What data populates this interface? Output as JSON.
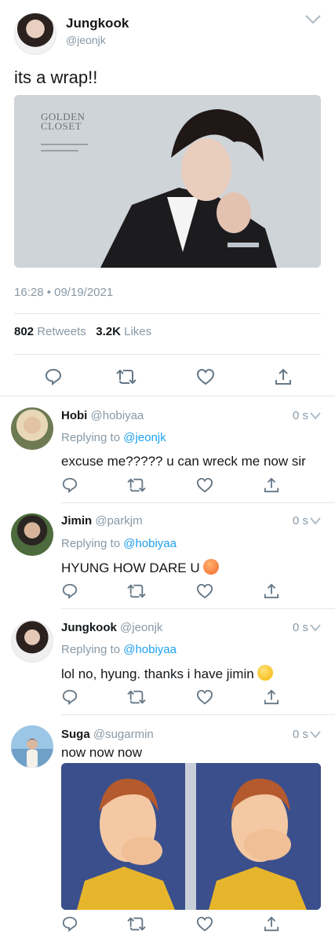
{
  "main_tweet": {
    "author_name": "Jungkook",
    "author_handle": "@jeonjk",
    "text": "its a wrap!!",
    "photo_title_line1": "GOLDEN",
    "photo_title_line2": "CLOSET",
    "timestamp": "16:28 • 09/19/2021",
    "retweets_count": "802",
    "retweets_label": "Retweets",
    "likes_count": "3.2K",
    "likes_label": "Likes"
  },
  "replies": [
    {
      "name": "Hobi",
      "handle": "@hobiyaa",
      "time": "0 s",
      "replying_prefix": "Replying to",
      "replying_to": "@jeonjk",
      "text": "excuse me????? u can wreck me now sir"
    },
    {
      "name": "Jimin",
      "handle": "@parkjm",
      "time": "0 s",
      "replying_prefix": "Replying to",
      "replying_to": "@hobiyaa",
      "text": "HYUNG HOW DARE U",
      "emoji": "angry-face"
    },
    {
      "name": "Jungkook",
      "handle": "@jeonjk",
      "time": "0 s",
      "replying_prefix": "Replying to",
      "replying_to": "@hobiyaa",
      "text": "lol no, hyung. thanks i have jimin",
      "emoji": "winking-face-with-tongue"
    },
    {
      "name": "Suga",
      "handle": "@sugarmin",
      "time": "0 s",
      "text": "now now now",
      "media": "meme-image"
    }
  ],
  "icons": {
    "reply": "reply-icon",
    "retweet": "retweet-icon",
    "like": "heart-icon",
    "share": "share-icon",
    "more": "chevron-down-icon"
  },
  "colors": {
    "link": "#1da1f2",
    "muted": "#8899a6",
    "text": "#14171a",
    "divider": "#e1e8ed"
  }
}
